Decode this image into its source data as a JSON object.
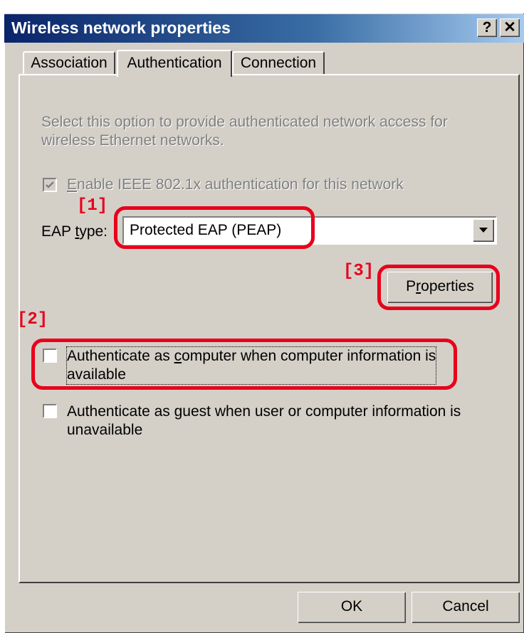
{
  "window": {
    "title": "Wireless network properties",
    "help_button": "?",
    "close_button": "✕"
  },
  "tabs": [
    {
      "label": "Association",
      "active": false
    },
    {
      "label": "Authentication",
      "active": true
    },
    {
      "label": "Connection",
      "active": false
    }
  ],
  "panel": {
    "description_line1": "Select this option to provide authenticated network access for",
    "description_line2": "wireless Ethernet networks.",
    "enable_8021x": {
      "label_first": "E",
      "label_rest": "nable IEEE 802.1x authentication for this network",
      "checked": true,
      "disabled": true
    },
    "eap_type": {
      "label_pre": "EAP ",
      "label_u": "t",
      "label_post": "ype:",
      "selected": "Protected EAP (PEAP)"
    },
    "properties_button": {
      "pre": "P",
      "u": "r",
      "post": "operties"
    },
    "auth_computer": {
      "line1_pre": "Authenticate as ",
      "line1_u": "c",
      "line1_post": "omputer when computer information is",
      "line2": "available",
      "checked": false
    },
    "auth_guest": {
      "line1_pre": "Authenticate as ",
      "line1_u": "g",
      "line1_post": "uest when user or computer information is",
      "line2": "unavailable",
      "checked": false
    }
  },
  "footer": {
    "ok": "OK",
    "cancel": "Cancel"
  },
  "annotations": {
    "marker1": "[1]",
    "marker2": "[2]",
    "marker3": "[3]"
  },
  "colors": {
    "annotation_red": "#e8001c",
    "titlebar_start": "#0a246a",
    "titlebar_end": "#a6caf0",
    "dialog_bg": "#d4d0c8"
  }
}
